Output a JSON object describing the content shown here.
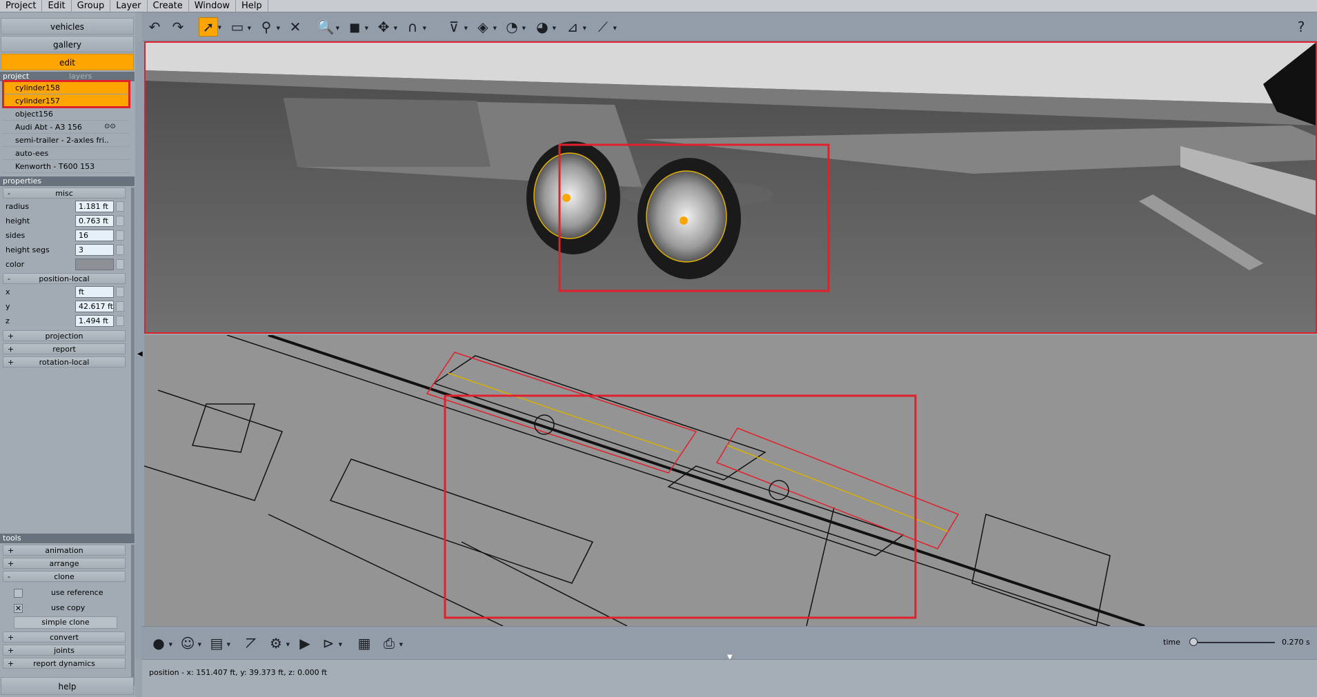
{
  "menu": [
    "Project",
    "Edit",
    "Group",
    "Layer",
    "Create",
    "Window",
    "Help"
  ],
  "nav": {
    "vehicles": "vehicles",
    "gallery": "gallery",
    "edit": "edit"
  },
  "project": {
    "header": "project",
    "tab_layers": "layers",
    "items": [
      {
        "label": "cylinder158",
        "selected": true
      },
      {
        "label": "cylinder157",
        "selected": true
      },
      {
        "label": "object156",
        "selected": false
      },
      {
        "label": "Audi Abt - A3 156",
        "selected": false,
        "icon": "eye-icon"
      },
      {
        "label": "semi-trailer - 2-axles fri..",
        "selected": false
      },
      {
        "label": "auto-ees",
        "selected": false
      },
      {
        "label": "Kenworth - T600 153",
        "selected": false
      }
    ]
  },
  "properties": {
    "header": "properties",
    "misc": {
      "label": "misc",
      "sign": "-",
      "radius_label": "radius",
      "radius": "1.181 ft",
      "height_label": "height",
      "height": "0.763 ft",
      "sides_label": "sides",
      "sides": "16",
      "height_segs_label": "height segs",
      "height_segs": "3",
      "color_label": "color",
      "color": "#8d9095"
    },
    "position_local": {
      "label": "position-local",
      "sign": "-",
      "x_label": "x",
      "x": "ft",
      "y_label": "y",
      "y": "42.617 ft",
      "z_label": "z",
      "z": "1.494 ft"
    },
    "projection": {
      "label": "projection",
      "sign": "+"
    },
    "report": {
      "label": "report",
      "sign": "+"
    },
    "rotation_local": {
      "label": "rotation-local",
      "sign": "+"
    }
  },
  "tools": {
    "header": "tools",
    "animation": {
      "label": "animation",
      "sign": "+"
    },
    "arrange": {
      "label": "arrange",
      "sign": "+"
    },
    "clone": {
      "label": "clone",
      "sign": "-",
      "use_reference_label": "use reference",
      "use_reference_checked": "",
      "use_copy_label": "use copy",
      "use_copy_checked": "✕",
      "simple_clone_label": "simple clone"
    },
    "convert": {
      "label": "convert",
      "sign": "+"
    },
    "joints": {
      "label": "joints",
      "sign": "+"
    },
    "report_dynamics": {
      "label": "report dynamics",
      "sign": "+"
    }
  },
  "help": "help",
  "toolbar_icons": [
    "undo-icon",
    "redo-icon",
    "select-arrow-icon",
    "rectangle-select-icon",
    "transform-gizmo-icon",
    "delete-icon",
    "zoom-icon",
    "box-icon",
    "move-icon",
    "magnet-icon",
    "bucket-icon",
    "plane-icon",
    "angle-measure-icon",
    "speedometer-icon",
    "dimension-icon",
    "tape-measure-icon",
    "help-icon"
  ],
  "timeline": {
    "time_label": "time",
    "time_value": "0.270 s",
    "progress": 0.0
  },
  "status": {
    "text": "position - x: 151.407 ft, y: 39.373 ft, z: 0.000 ft"
  },
  "colors": {
    "accent": "#ffa500",
    "highlight": "#e0202a",
    "panel": "#a2abb4"
  }
}
